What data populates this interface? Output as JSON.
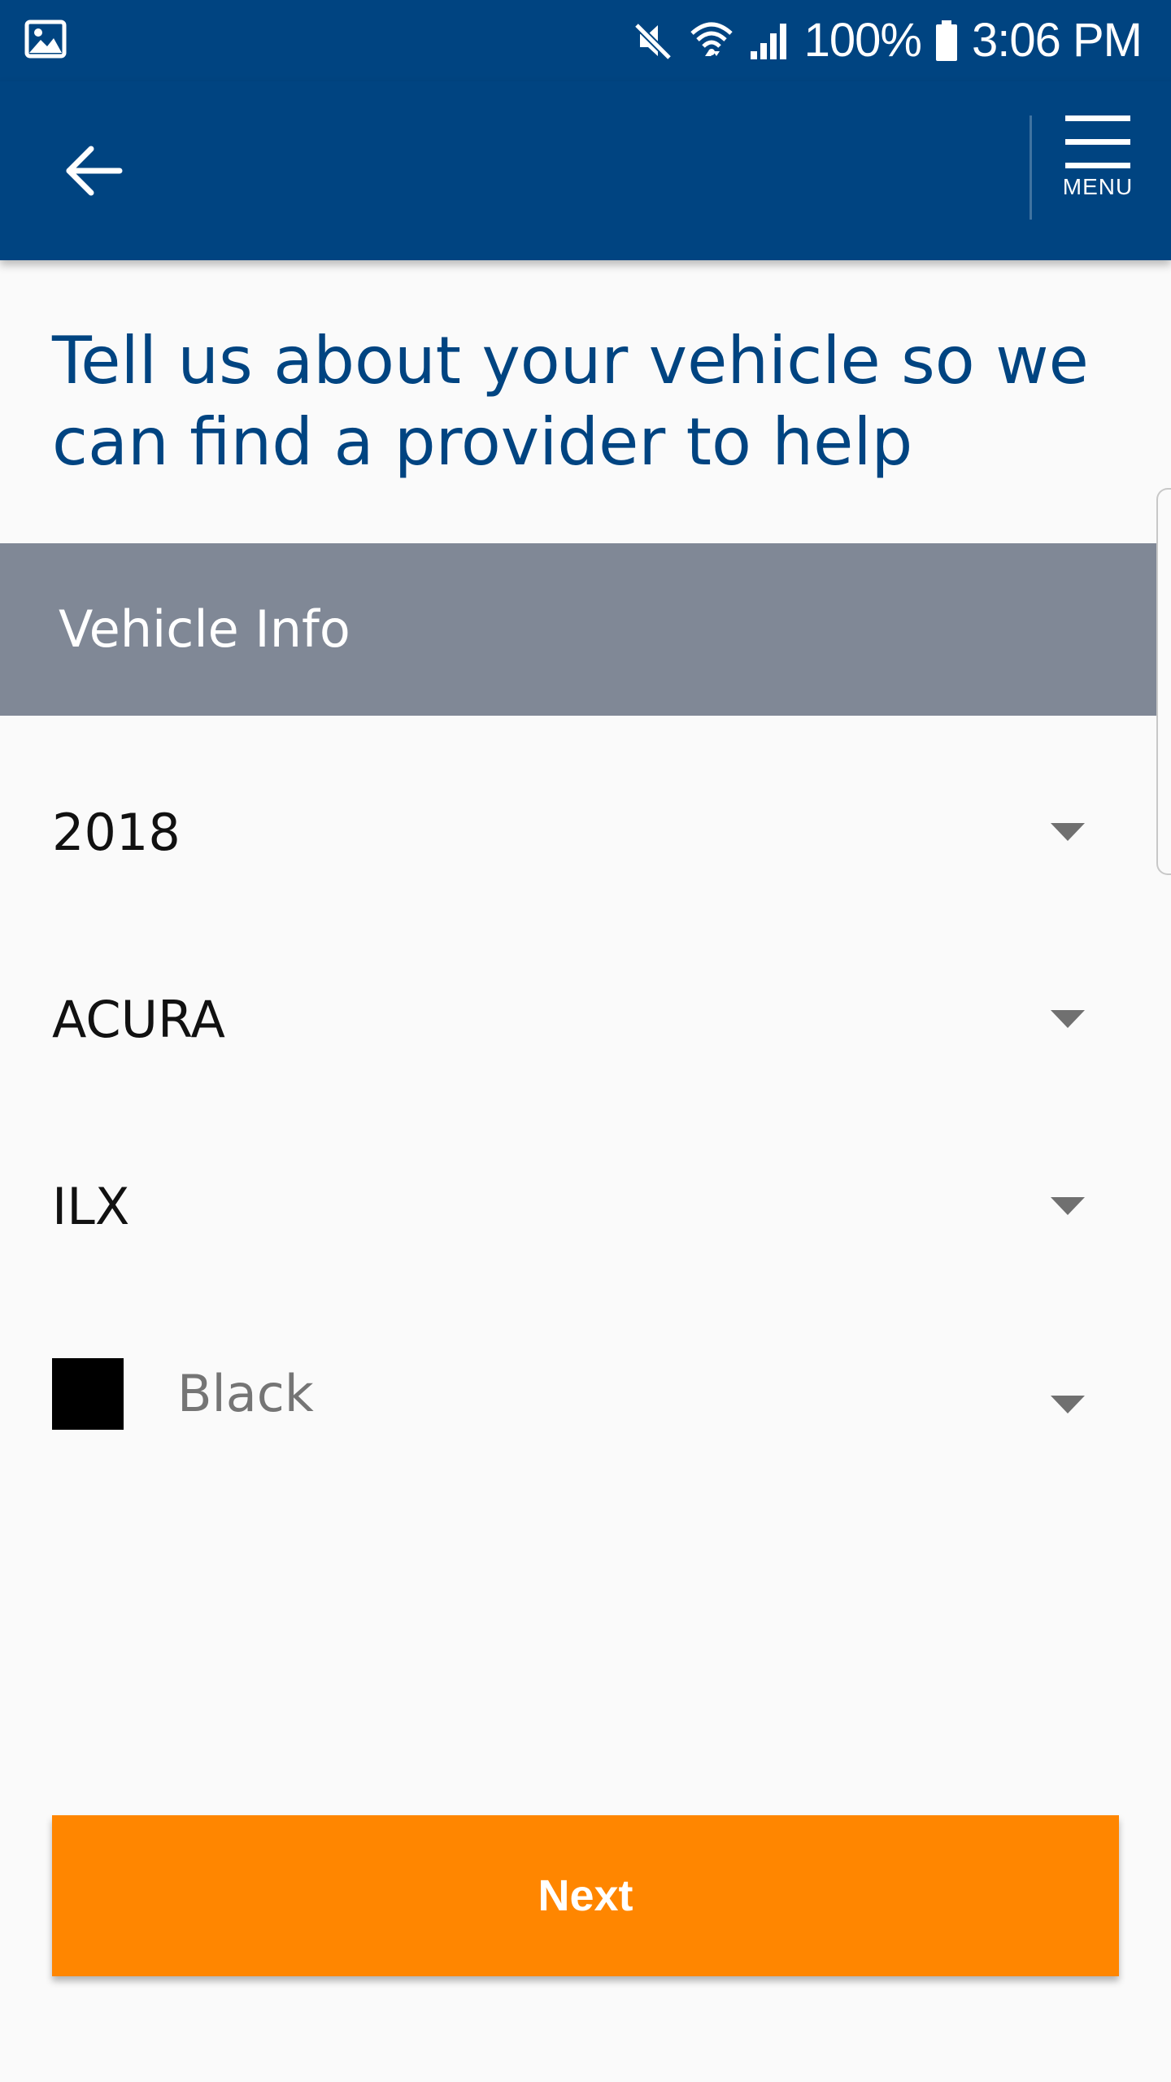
{
  "status_bar": {
    "battery": "100%",
    "time": "3:06 PM"
  },
  "app_bar": {
    "menu_label": "MENU"
  },
  "heading": "Tell us about your vehicle so we can find a provider to help",
  "section": {
    "title": "Vehicle Info"
  },
  "vehicle": {
    "year": "2018",
    "make": "ACURA",
    "model": "ILX",
    "color": "Black"
  },
  "actions": {
    "next_label": "Next"
  },
  "colors": {
    "brand_blue": "#004481",
    "section_gray": "#808896",
    "accent_orange": "#ff8600",
    "swatch_color": "#000000"
  }
}
